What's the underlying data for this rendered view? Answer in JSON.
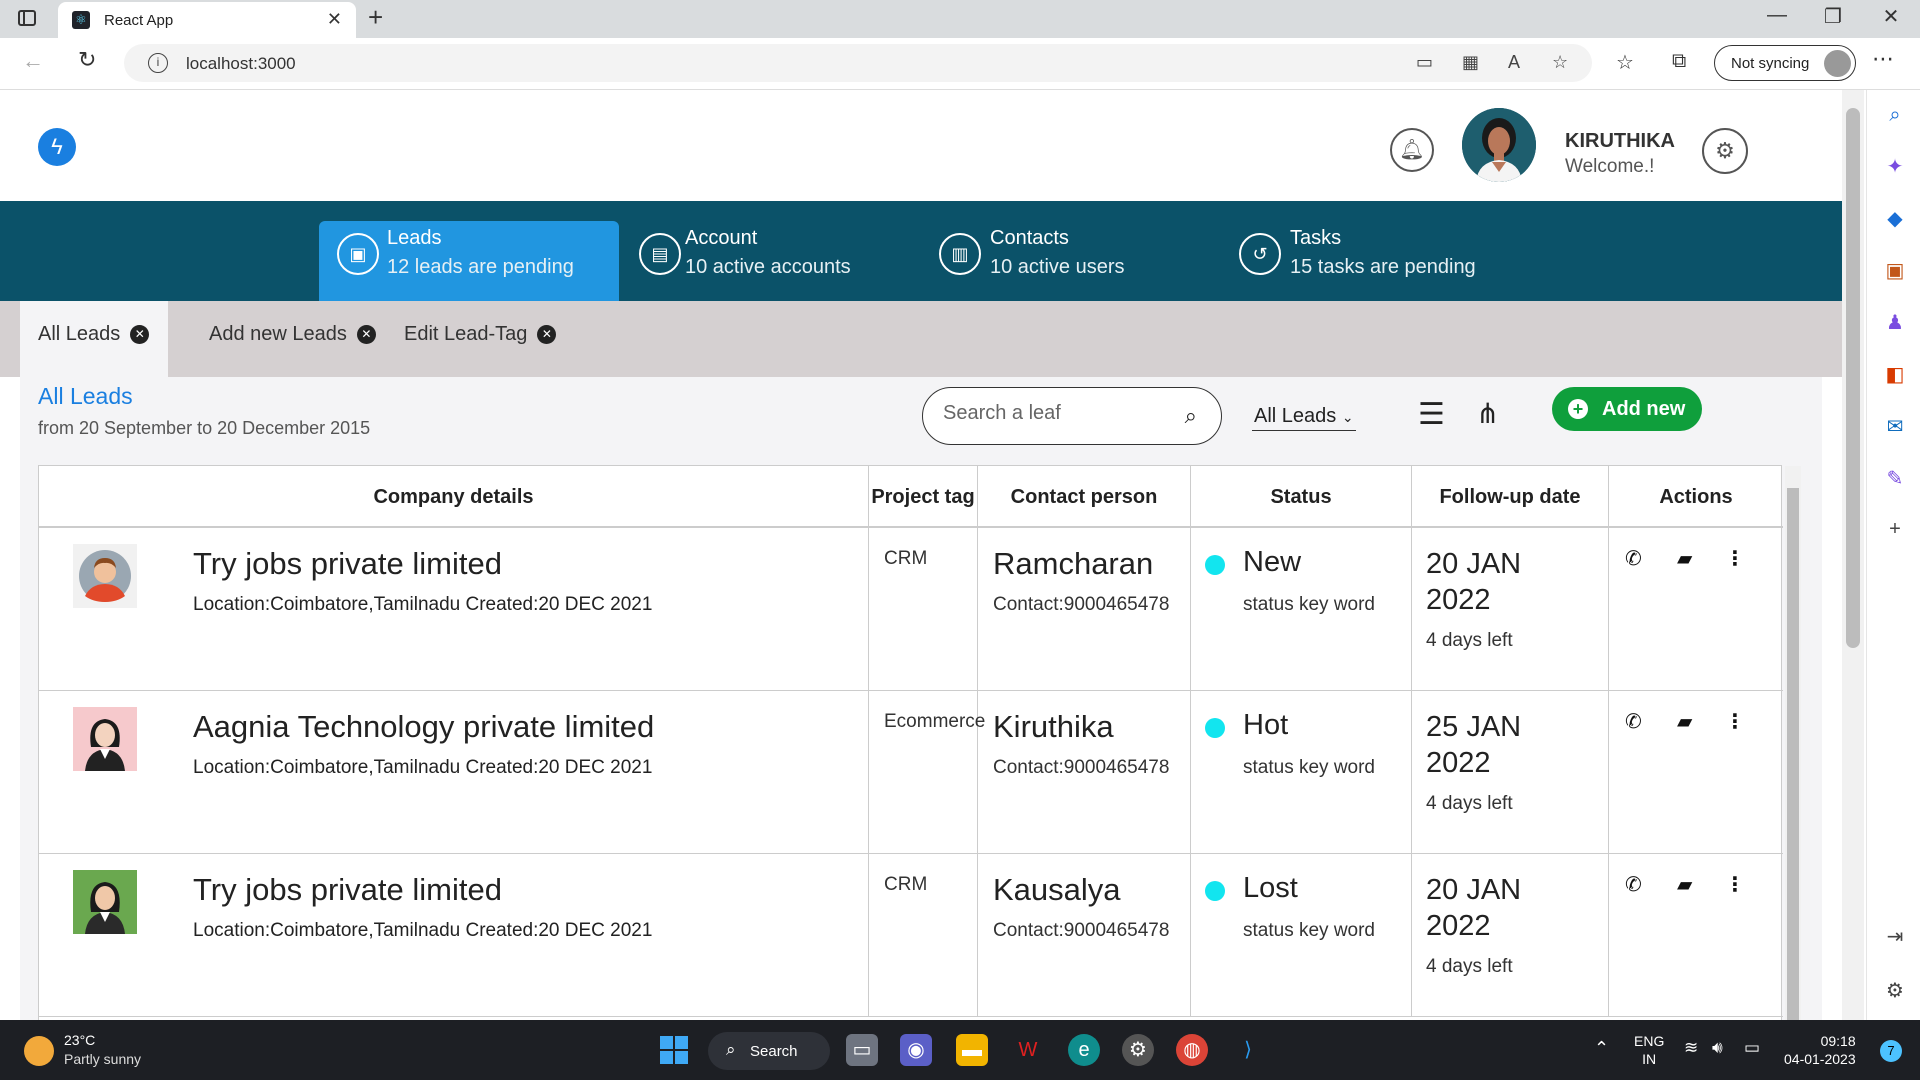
{
  "browser": {
    "tab_title": "React App",
    "url": "localhost:3000",
    "sync_label": "Not syncing"
  },
  "header": {
    "user_name": "KIRUTHIKA",
    "user_welcome": "Welcome.!"
  },
  "nav": [
    {
      "title": "Leads",
      "subtitle": "12 leads are pending",
      "active": true
    },
    {
      "title": "Account",
      "subtitle": "10 active accounts",
      "active": false
    },
    {
      "title": "Contacts",
      "subtitle": "10 active users",
      "active": false
    },
    {
      "title": "Tasks",
      "subtitle": "15 tasks are pending",
      "active": false
    }
  ],
  "subtabs": [
    {
      "label": "All Leads"
    },
    {
      "label": "Add new Leads"
    },
    {
      "label": "Edit Lead-Tag"
    }
  ],
  "section": {
    "title": "All Leads",
    "range": "from 20 September to 20 December 2015"
  },
  "search": {
    "placeholder": "Search a leaf"
  },
  "filter": {
    "selected": "All Leads"
  },
  "add_button": {
    "label": "Add new"
  },
  "table": {
    "headers": [
      "Company details",
      "Project tag",
      "Contact person",
      "Status",
      "Follow-up date",
      "Actions"
    ],
    "rows": [
      {
        "company": "Try jobs private limited",
        "meta": "Location:Coimbatore,Tamilnadu Created:20 DEC 2021",
        "tag": "CRM",
        "person": "Ramcharan",
        "contact": "Contact:9000465478",
        "status": "New",
        "keyword": "status key word",
        "date": "20 JAN 2022",
        "left": "4 days left"
      },
      {
        "company": "Aagnia Technology private limited",
        "meta": "Location:Coimbatore,Tamilnadu Created:20 DEC 2021",
        "tag": "Ecommerce",
        "person": "Kiruthika",
        "contact": "Contact:9000465478",
        "status": "Hot",
        "keyword": "status key word",
        "date": "25 JAN 2022",
        "left": "4 days left"
      },
      {
        "company": "Try jobs private limited",
        "meta": "Location:Coimbatore,Tamilnadu Created:20 DEC 2021",
        "tag": "CRM",
        "person": "Kausalya",
        "contact": "Contact:9000465478",
        "status": "Lost",
        "keyword": "status key word",
        "date": "20 JAN 2022",
        "left": "4 days left"
      }
    ]
  },
  "taskbar": {
    "weather_temp": "23°C",
    "weather_desc": "Partly sunny",
    "search_label": "Search",
    "lang_line1": "ENG",
    "lang_line2": "IN",
    "time": "09:18",
    "date": "04-01-2023",
    "notifications": "7"
  },
  "colors": {
    "nav_band": "#0b5269",
    "active_nav": "#2196e0",
    "add_button": "#0f9f3c",
    "status_dot": "#12e5ef",
    "link": "#1a7fe0"
  },
  "icons": {
    "logo": "lightning-bolt-icon",
    "bell": "bell-icon",
    "settings": "gear-icon",
    "row_actions": [
      "phone-icon",
      "chat-icon",
      "more-vertical-icon"
    ]
  }
}
